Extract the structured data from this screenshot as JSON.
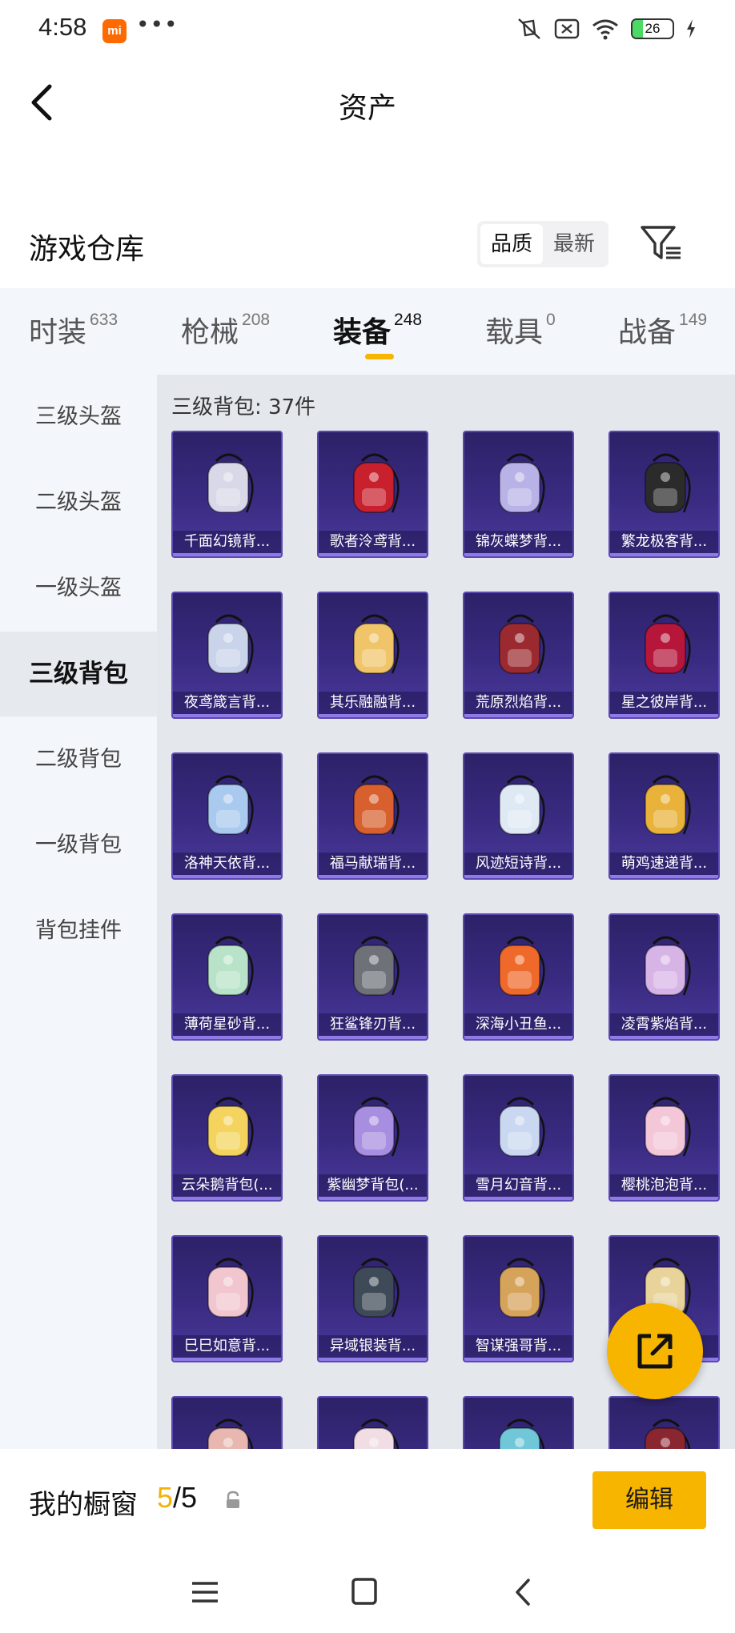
{
  "status_bar": {
    "time": "4:58",
    "app_badge": "mi",
    "more": "•••",
    "battery": "26",
    "battery_level": 0.26
  },
  "header": {
    "title": "资产"
  },
  "warehouse": {
    "title": "游戏仓库",
    "sort_options": [
      "品质",
      "最新"
    ],
    "active_sort": "品质"
  },
  "tabs": [
    {
      "label": "时装",
      "count": "633"
    },
    {
      "label": "枪械",
      "count": "208"
    },
    {
      "label": "装备",
      "count": "248"
    },
    {
      "label": "载具",
      "count": "0"
    },
    {
      "label": "战备",
      "count": "149"
    }
  ],
  "active_tab": "装备",
  "sidebar": {
    "items": [
      "三级头盔",
      "二级头盔",
      "一级头盔",
      "三级背包",
      "二级背包",
      "一级背包",
      "背包挂件"
    ],
    "active": "三级背包"
  },
  "grid": {
    "header": "三级背包: 37件",
    "items": [
      {
        "name": "千面幻镜背...",
        "color": "#d8d8e8"
      },
      {
        "name": "歌者泠鸢背...",
        "color": "#c8202c"
      },
      {
        "name": "锦灰蝶梦背...",
        "color": "#b9b2e6"
      },
      {
        "name": "繁龙极客背...",
        "color": "#2b2b2b"
      },
      {
        "name": "夜鸢箴言背...",
        "color": "#c9d4ea"
      },
      {
        "name": "其乐融融背...",
        "color": "#f0c56a"
      },
      {
        "name": "荒原烈焰背...",
        "color": "#9a2a30"
      },
      {
        "name": "星之彼岸背...",
        "color": "#b5163a"
      },
      {
        "name": "洛神天依背...",
        "color": "#a9c9ef"
      },
      {
        "name": "福马献瑞背...",
        "color": "#d8602e"
      },
      {
        "name": "风迹短诗背...",
        "color": "#dfe9f4"
      },
      {
        "name": "萌鸡速递背...",
        "color": "#e9b23a"
      },
      {
        "name": "薄荷星砂背...",
        "color": "#b8e3c8"
      },
      {
        "name": "狂鲨锋刃背...",
        "color": "#6e7278"
      },
      {
        "name": "深海小丑鱼...",
        "color": "#ef6a2a"
      },
      {
        "name": "凌霄紫焰背...",
        "color": "#d7b4e6"
      },
      {
        "name": "云朵鹅背包(...",
        "color": "#f4d45e"
      },
      {
        "name": "紫幽梦背包(...",
        "color": "#a88ee0"
      },
      {
        "name": "雪月幻音背...",
        "color": "#c9d8f0"
      },
      {
        "name": "樱桃泡泡背...",
        "color": "#f3c7d8"
      },
      {
        "name": "巳巳如意背...",
        "color": "#f1c6cf"
      },
      {
        "name": "异域银装背...",
        "color": "#3e4a57"
      },
      {
        "name": "智谋强哥背...",
        "color": "#d6a35a"
      },
      {
        "name": ")",
        "color": "#e8d39a"
      },
      {
        "name": "",
        "color": "#e8b8b0"
      },
      {
        "name": "",
        "color": "#f1dde4"
      },
      {
        "name": "",
        "color": "#6fc7d8"
      },
      {
        "name": "",
        "color": "#8a2630"
      }
    ]
  },
  "bottom_bar": {
    "label": "我的橱窗",
    "current": "5",
    "separator": "/",
    "total": "5",
    "edit_label": "编辑"
  },
  "colors": {
    "accent": "#f7b500",
    "card_bg": "#3a2b82",
    "sidebar_bg": "#f3f6fa",
    "grid_bg": "#e4e7ec"
  }
}
